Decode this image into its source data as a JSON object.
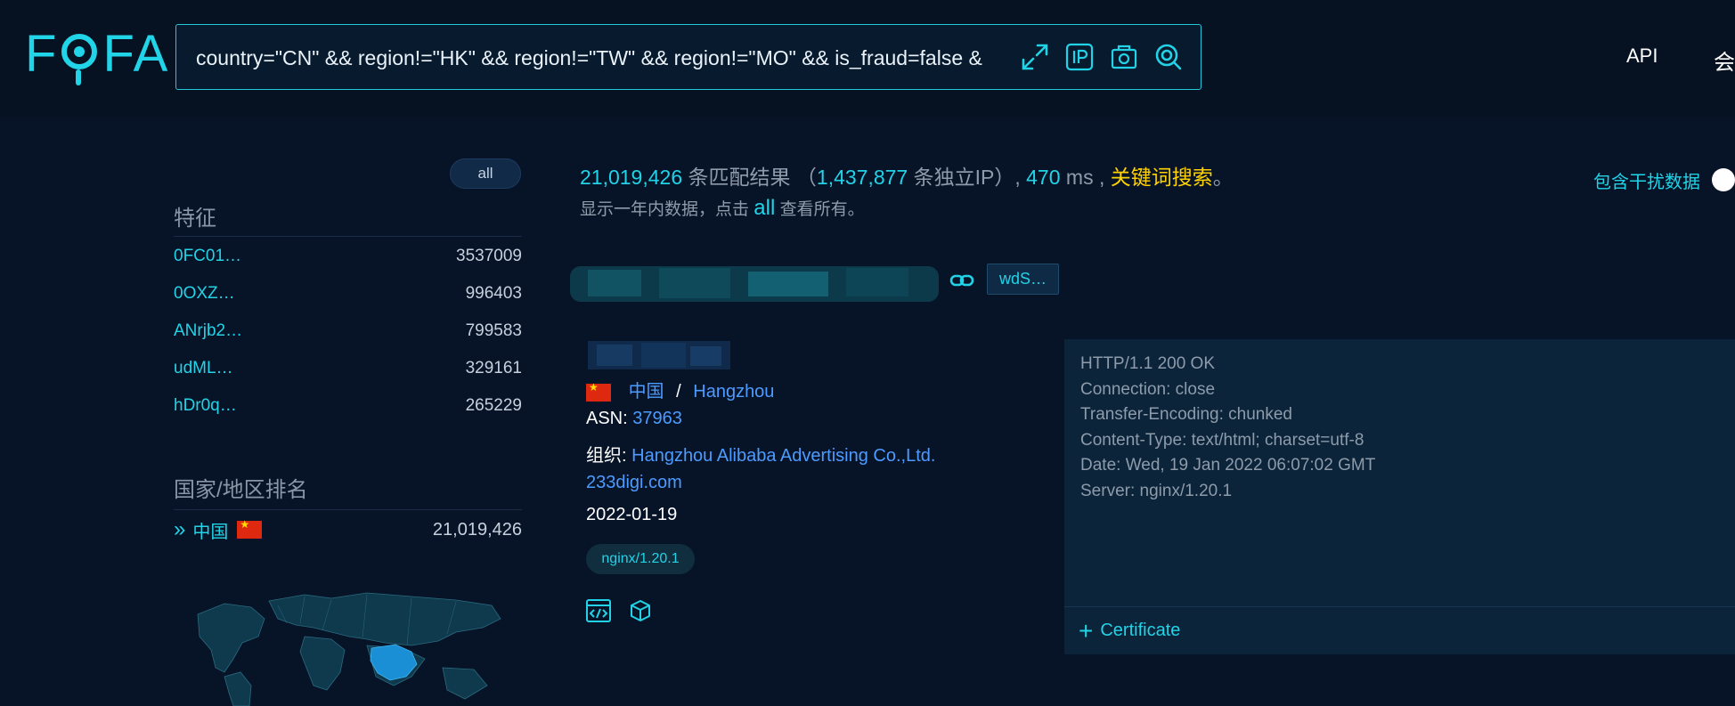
{
  "header": {
    "logo_text": {
      "f": "F",
      "fa": "FA"
    },
    "search_query": "country=\"CN\" && region!=\"HK\" && region!=\"TW\" && region!=\"MO\" && is_fraud=false &",
    "search_icons": [
      "expand-icon",
      "ip-icon",
      "screenshot-icon",
      "search-icon"
    ],
    "nav": {
      "api": "API",
      "more": "会"
    }
  },
  "sidebar": {
    "all_label": "all",
    "features_title": "特征",
    "features": [
      {
        "key": "0FC01…",
        "count": "3537009"
      },
      {
        "key": "0OXZ…",
        "count": "996403"
      },
      {
        "key": "ANrjb2…",
        "count": "799583"
      },
      {
        "key": "udML…",
        "count": "329161"
      },
      {
        "key": "hDr0q…",
        "count": "265229"
      }
    ],
    "country_title": "国家/地区排名",
    "countries": [
      {
        "name": "中国",
        "count": "21,019,426"
      }
    ]
  },
  "results": {
    "total": "21,019,426",
    "total_label": "条匹配结果",
    "paren_open": "（",
    "unique_ip": "1,437,877",
    "unique_ip_label": "条独立IP）,",
    "time_ms": "470",
    "time_unit": "ms ,",
    "keyword_link": "关键词搜索",
    "period": "。",
    "note_before": "显示一年内数据，点击",
    "note_all": "all",
    "note_after": "查看所有。",
    "toggle_label": "包含干扰数据"
  },
  "record": {
    "tag": "wdS…",
    "country": "中国",
    "separator": "/",
    "city": "Hangzhou",
    "asn_label": "ASN:",
    "asn": "37963",
    "org_label": "组织:",
    "org": "Hangzhou Alibaba Advertising Co.,Ltd.",
    "domain": "233digi.com",
    "date": "2022-01-19",
    "server": "nginx/1.20.1",
    "banner": "HTTP/1.1 200 OK\nConnection: close\nTransfer-Encoding: chunked\nContent-Type: text/html; charset=utf-8\nDate: Wed, 19 Jan 2022 06:07:02 GMT\nServer: nginx/1.20.1",
    "certificate_label": "Certificate"
  },
  "colors": {
    "accent": "#22d3e7",
    "link": "#4d9bff",
    "keyword": "#ffd200",
    "background": "#071428"
  }
}
